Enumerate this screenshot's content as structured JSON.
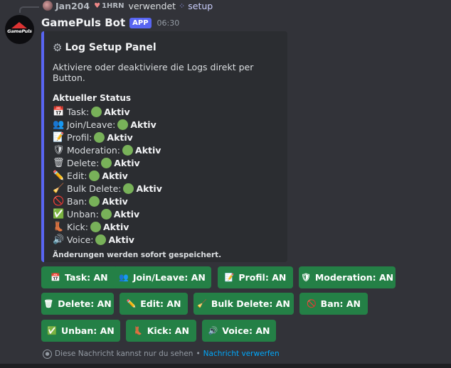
{
  "reply": {
    "username": "Jan204",
    "tag_label": "1HRN",
    "action_text": "verwendet",
    "command": "setup"
  },
  "message": {
    "bot_name": "GamePuls Bot",
    "badge": "APP",
    "timestamp": "06:30",
    "avatar_text": "GamePuls"
  },
  "embed": {
    "accent_color": "#5865f2",
    "title": "Log Setup Panel",
    "description": "Aktiviere oder deaktiviere die Logs direkt per Button.",
    "status_heading": "Aktueller Status",
    "status_rows": [
      {
        "icon": "📅",
        "label": "Task:",
        "value": "Aktiv"
      },
      {
        "icon": "👥",
        "label": "Join/Leave:",
        "value": "Aktiv"
      },
      {
        "icon": "📝",
        "label": "Profil:",
        "value": "Aktiv"
      },
      {
        "icon": "🛡",
        "label": "Moderation:",
        "value": "Aktiv"
      },
      {
        "icon": "🗑",
        "label": "Delete:",
        "value": "Aktiv"
      },
      {
        "icon": "✏️",
        "label": "Edit:",
        "value": "Aktiv"
      },
      {
        "icon": "🧹",
        "label": "Bulk Delete:",
        "value": "Aktiv"
      },
      {
        "icon": "🚫",
        "label": "Ban:",
        "value": "Aktiv"
      },
      {
        "icon": "✅",
        "label": "Unban:",
        "value": "Aktiv"
      },
      {
        "icon": "👢",
        "label": "Kick:",
        "value": "Aktiv"
      },
      {
        "icon": "🔊",
        "label": "Voice:",
        "value": "Aktiv"
      }
    ],
    "footer": "Änderungen werden sofort gespeichert."
  },
  "buttons": {
    "color": "#248046",
    "task": {
      "icon": "📅",
      "label": "Task: AN"
    },
    "join_leave": {
      "icon": "👥",
      "label": "Join/Leave: AN"
    },
    "profil": {
      "icon": "📝",
      "label": "Profil: AN"
    },
    "moderation": {
      "icon": "🛡",
      "label": "Moderation: AN"
    },
    "delete": {
      "icon": "🗑",
      "label": "Delete: AN"
    },
    "edit": {
      "icon": "✏️",
      "label": "Edit: AN"
    },
    "bulk_delete": {
      "icon": "🧹",
      "label": "Bulk Delete: AN"
    },
    "ban": {
      "icon": "🚫",
      "label": "Ban: AN"
    },
    "unban": {
      "icon": "✅",
      "label": "Unban: AN"
    },
    "kick": {
      "icon": "👢",
      "label": "Kick: AN"
    },
    "voice": {
      "icon": "🔊",
      "label": "Voice: AN"
    }
  },
  "ephemeral": {
    "notice": "Diese Nachricht kannst nur du sehen",
    "separator": "•",
    "dismiss": "Nachricht verwerfen"
  }
}
